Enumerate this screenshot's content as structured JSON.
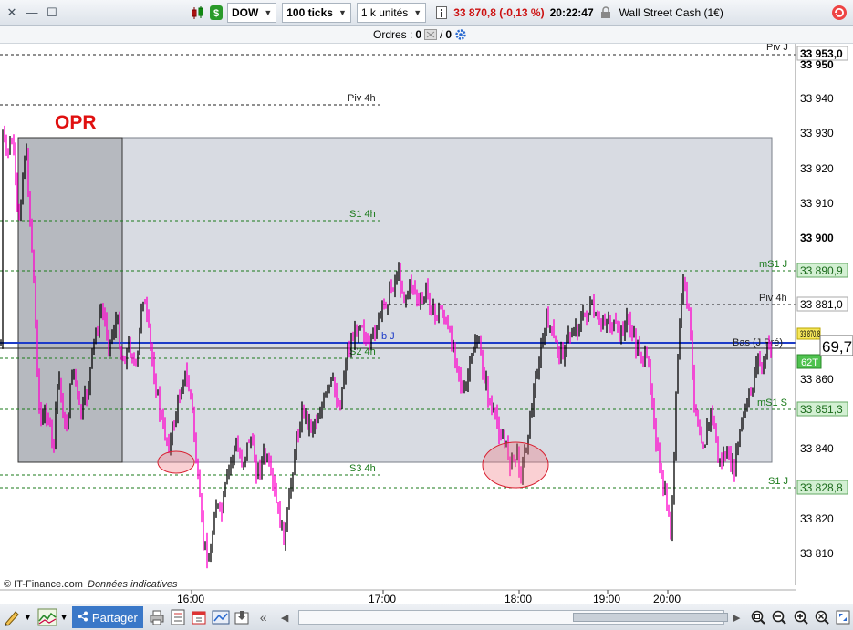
{
  "toolbar": {
    "instrument": "DOW",
    "ticks": "100 ticks",
    "units": "1 k unités",
    "price_change": "33 870,8 (-0,13 %)",
    "time": "20:22:47",
    "instrument_name": "Wall Street Cash (1€)"
  },
  "orders": {
    "label": "Ordres :",
    "count1": "0",
    "sep": "/",
    "count2": "0"
  },
  "chart": {
    "watermark_opr": "OPR",
    "source": "© IT-Finance.com",
    "source_note": "Données indicatives",
    "colors": {
      "up": "#000000",
      "down": "#ff00cc",
      "support": "#1a7a1a",
      "pivot": "#000000",
      "blue_line": "#1e3cc8"
    },
    "price_labels": [
      "33 950",
      "33 940",
      "33 930",
      "33 920",
      "33 910",
      "33 900",
      "33 860",
      "33 840",
      "33 820",
      "33 810"
    ],
    "level_tags": [
      {
        "text": "33 953,0",
        "price": 33953.0,
        "style": "plain"
      },
      {
        "text": "33 890,9",
        "price": 33890.9,
        "style": "green"
      },
      {
        "text": "33 881,0",
        "price": 33881.0,
        "style": "plain"
      },
      {
        "text": "33 870,8",
        "price": 33870.8,
        "style": "yellow"
      },
      {
        "text": "62T",
        "price": 33866.0,
        "style": "green"
      },
      {
        "text": "33 851,3",
        "price": 33851.3,
        "style": "green"
      },
      {
        "text": "33 828,8",
        "price": 33828.8,
        "style": "green"
      }
    ],
    "current_price_big": "69,7",
    "line_labels": {
      "piv_j": "Piv J",
      "piv_4h_a": "Piv 4h",
      "s1_4h": "S1 4h",
      "s2_4h": "S2 4h",
      "s3_4h": "S3 4h",
      "ms1_j": "mS1 J",
      "piv_4h_b": "Piv 4h",
      "bas_j_pre": "Bas (J Pré)",
      "ms1_s": "mS1 S",
      "s1_j": "S1 J",
      "blue_label": "b J"
    },
    "time_labels": [
      "16:00",
      "17:00",
      "18:00",
      "19:00",
      "20:00"
    ]
  },
  "bottombar": {
    "share_label": "Partager"
  }
}
